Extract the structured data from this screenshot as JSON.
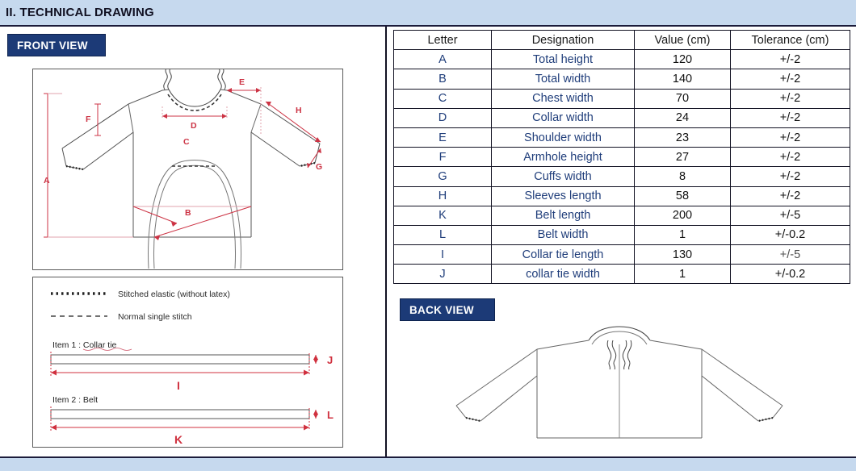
{
  "header": {
    "title": "II. TECHNICAL DRAWING",
    "band_color": "#c6d9ee"
  },
  "views": {
    "front_label": "FRONT VIEW",
    "back_label": "BACK VIEW",
    "badge_color": "#1c3a77"
  },
  "front_drawing": {
    "dimension_labels": [
      "A",
      "B",
      "C",
      "D",
      "E",
      "F",
      "G",
      "H"
    ],
    "label_color": "#cc3344",
    "outline_color": "#555555"
  },
  "back_drawing": {
    "outline_color": "#555555"
  },
  "legend": {
    "items": [
      {
        "style": "dotted",
        "label": "Stitched elastic (without latex)"
      },
      {
        "style": "dashed",
        "label": "Normal single stitch"
      }
    ],
    "item1_label": "Item 1 : Collar tie",
    "item1_length_dim": "I",
    "item1_width_dim": "J",
    "item2_label": "Item 2 : Belt",
    "item2_length_dim": "K",
    "item2_width_dim": "L"
  },
  "table": {
    "columns": [
      "Letter",
      "Designation",
      "Value (cm)",
      "Tolerance (cm)"
    ],
    "rows": [
      {
        "letter": "A",
        "designation": "Total height",
        "value": "120",
        "tolerance": "+/-2"
      },
      {
        "letter": "B",
        "designation": "Total width",
        "value": "140",
        "tolerance": "+/-2"
      },
      {
        "letter": "C",
        "designation": "Chest width",
        "value": "70",
        "tolerance": "+/-2"
      },
      {
        "letter": "D",
        "designation": "Collar width",
        "value": "24",
        "tolerance": "+/-2"
      },
      {
        "letter": "E",
        "designation": "Shoulder width",
        "value": "23",
        "tolerance": "+/-2"
      },
      {
        "letter": "F",
        "designation": "Armhole height",
        "value": "27",
        "tolerance": "+/-2"
      },
      {
        "letter": "G",
        "designation": "Cuffs width",
        "value": "8",
        "tolerance": "+/-2"
      },
      {
        "letter": "H",
        "designation": "Sleeves length",
        "value": "58",
        "tolerance": "+/-2"
      },
      {
        "letter": "K",
        "designation": "Belt length",
        "value": "200",
        "tolerance": "+/-5"
      },
      {
        "letter": "L",
        "designation": "Belt width",
        "value": "1",
        "tolerance": "+/-0.2"
      },
      {
        "letter": "I",
        "designation": "Collar tie length",
        "value": "130",
        "tolerance": "+/-5"
      },
      {
        "letter": "J",
        "designation": "collar tie width",
        "value": "1",
        "tolerance": "+/-0.2"
      }
    ]
  }
}
